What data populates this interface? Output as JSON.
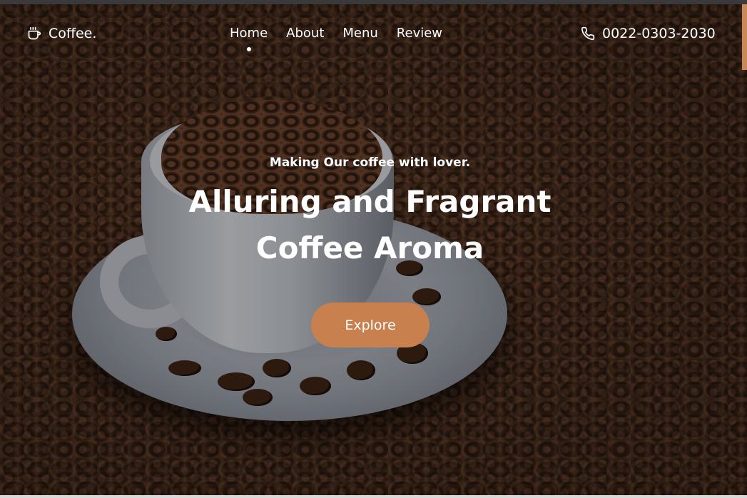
{
  "colors": {
    "accent": "#c8804f",
    "text": "#ffffff",
    "scrollbar": "#c88a5a"
  },
  "header": {
    "logo_icon": "coffee-cup-icon",
    "logo_text": "Coffee.",
    "nav": [
      {
        "label": "Home",
        "active": true
      },
      {
        "label": "About",
        "active": false
      },
      {
        "label": "Menu",
        "active": false
      },
      {
        "label": "Review",
        "active": false
      }
    ],
    "phone_icon": "phone-icon",
    "phone_number": "0022-0303-2030"
  },
  "hero": {
    "image": "coffee-cup-with-beans-photo",
    "tagline": "Making Our coffee with lover.",
    "headline_line1": "Alluring and Fragrant",
    "headline_line2": "Coffee Aroma",
    "cta_label": "Explore"
  }
}
